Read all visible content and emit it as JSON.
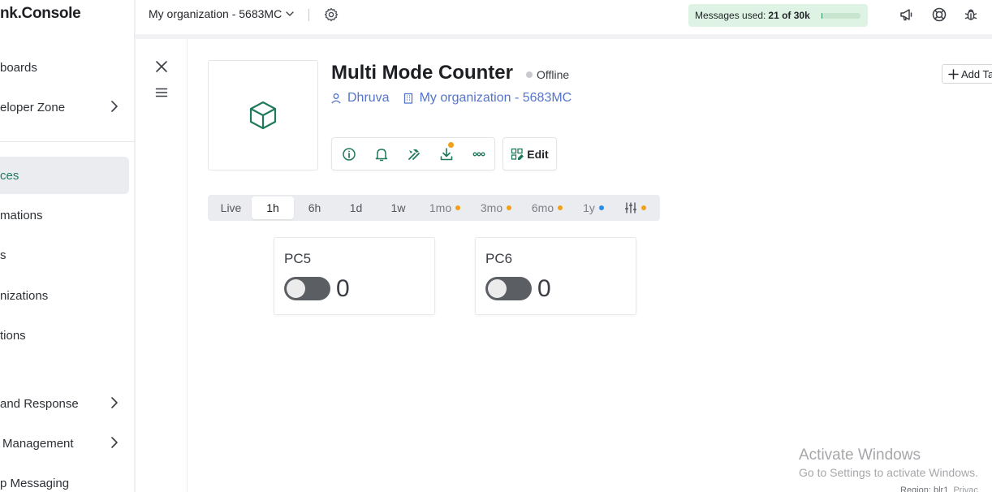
{
  "app": {
    "brand": "nk.Console"
  },
  "sidebar": {
    "items": [
      {
        "label": "boards",
        "has_chevron": false,
        "active": false
      },
      {
        "label": "eloper Zone",
        "has_chevron": true,
        "active": false
      },
      {
        "label": "ces",
        "has_chevron": false,
        "active": true
      },
      {
        "label": "mations",
        "has_chevron": false,
        "active": false
      },
      {
        "label": "s",
        "has_chevron": false,
        "active": false
      },
      {
        "label": "nizations",
        "has_chevron": false,
        "active": false
      },
      {
        "label": "tions",
        "has_chevron": false,
        "active": false
      },
      {
        "label": "and Response",
        "has_chevron": true,
        "active": false
      },
      {
        "label": "Management",
        "has_chevron": true,
        "active": false
      },
      {
        "label": "p Messaging",
        "has_chevron": false,
        "active": false
      }
    ]
  },
  "header": {
    "org_name": "My organization - 5683MC",
    "messages_label": "Messages used:",
    "messages_value": "21 of 30k",
    "messages_fraction": 0.0007,
    "icons": [
      "megaphone-icon",
      "lifebuoy-icon",
      "bug-icon"
    ]
  },
  "device": {
    "title": "Multi Mode Counter",
    "status": "Offline",
    "owner": "Dhruva",
    "organization": "My organization - 5683MC",
    "edit_label": "Edit",
    "add_tag_label": "Add Ta",
    "toolbar_icons": [
      "info-icon",
      "bell-icon",
      "tools-icon",
      "download-icon",
      "more-icon"
    ]
  },
  "time_tabs": [
    {
      "label": "Live",
      "active": false,
      "muted": false,
      "dot": null
    },
    {
      "label": "1h",
      "active": true,
      "muted": false,
      "dot": null
    },
    {
      "label": "6h",
      "active": false,
      "muted": false,
      "dot": null
    },
    {
      "label": "1d",
      "active": false,
      "muted": false,
      "dot": null
    },
    {
      "label": "1w",
      "active": false,
      "muted": false,
      "dot": null
    },
    {
      "label": "1mo",
      "active": false,
      "muted": true,
      "dot": "#f0a019"
    },
    {
      "label": "3mo",
      "active": false,
      "muted": true,
      "dot": "#f0a019"
    },
    {
      "label": "6mo",
      "active": false,
      "muted": true,
      "dot": "#f0a019"
    },
    {
      "label": "1y",
      "active": false,
      "muted": true,
      "dot": "#2b8ce8"
    }
  ],
  "widgets": [
    {
      "title": "PC5",
      "value": "0",
      "switch_on": false
    },
    {
      "title": "PC6",
      "value": "0",
      "switch_on": false
    }
  ],
  "watermark": {
    "line1": "Activate Windows",
    "line2": "Go to Settings to activate Windows."
  },
  "footer": {
    "region": "Region: blr1",
    "privacy": "Privac"
  },
  "colors": {
    "accent_green": "#1f7a5a",
    "link_blue": "#5575cc",
    "badge_orange": "#f0a019",
    "badge_blue": "#2b8ce8",
    "message_pill": "#def3e4"
  }
}
